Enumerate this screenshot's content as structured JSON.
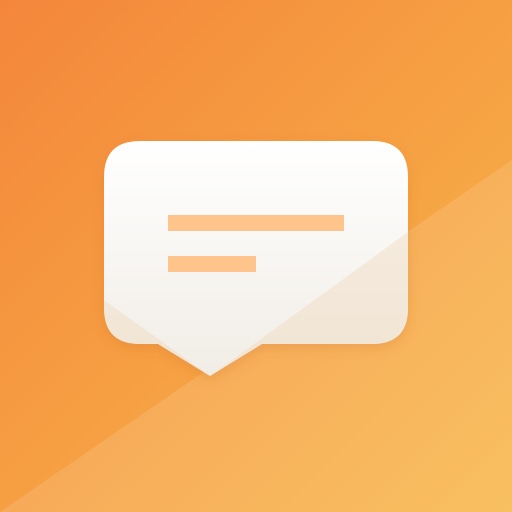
{
  "icon": {
    "semantic_name": "message-bubble-icon",
    "description_text_lines": 2
  },
  "colors": {
    "background_top_left": "#F4863B",
    "background_bottom_right": "#F8B84A",
    "bubble_top": "#FFFFFF",
    "bubble_bottom": "#F1EDE6",
    "text_line": "#FFC48C",
    "diagonal_overlay": "#FFFFFF"
  }
}
